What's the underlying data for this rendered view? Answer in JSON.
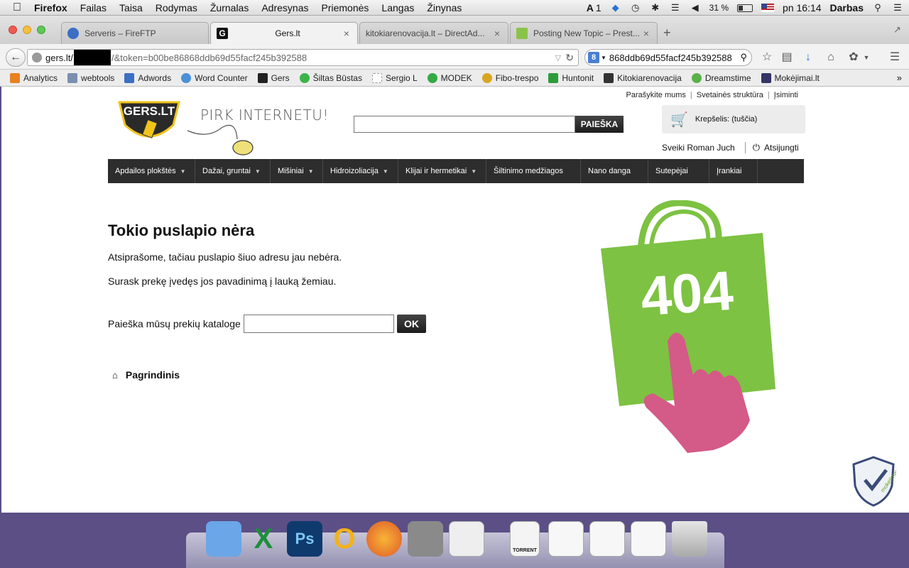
{
  "menubar": {
    "app": "Firefox",
    "items": [
      "Failas",
      "Taisa",
      "Rodymas",
      "Žurnalas",
      "Adresynas",
      "Priemonės",
      "Langas",
      "Žinynas"
    ],
    "status": {
      "adobe_count": "1",
      "battery": "31 %",
      "clock": "pn 16:14",
      "user": "Darbas"
    }
  },
  "tabs": [
    {
      "title": "Serveris – FireFTP"
    },
    {
      "title": "Gers.lt"
    },
    {
      "title": "kitokiarenovacija.lt – DirectAd..."
    },
    {
      "title": "Posting New Topic – Prest..."
    }
  ],
  "navbar": {
    "url_host": "gers.lt/",
    "url_rest": "/&token=b00be86868ddb69d55facf245b392588",
    "search_value": "868ddb69d55facf245b392588"
  },
  "bookmarks": [
    {
      "label": "Analytics",
      "color": "#e8821e"
    },
    {
      "label": "webtools",
      "color": "#7a8fb0"
    },
    {
      "label": "Adwords",
      "color": "#3a6fc4"
    },
    {
      "label": "Word Counter",
      "color": "#4a90d9"
    },
    {
      "label": "Gers",
      "color": "#222222"
    },
    {
      "label": "Šiltas Būstas",
      "color": "#3cb44a"
    },
    {
      "label": "Sergio L",
      "color": "#cccccc"
    },
    {
      "label": "MODEK",
      "color": "#33aa44"
    },
    {
      "label": "Fibo-trespo",
      "color": "#d9a520"
    },
    {
      "label": "Huntonit",
      "color": "#2e9b3a"
    },
    {
      "label": "Kitokiarenovacija",
      "color": "#333333"
    },
    {
      "label": "Dreamstime",
      "color": "#5bb14a"
    },
    {
      "label": "Mokėjimai.lt",
      "color": "#333366"
    }
  ],
  "site": {
    "top_links": [
      "Parašykite mums",
      "Svetainės struktūra",
      "Įsiminti"
    ],
    "logo_text": "GERS.LT",
    "slogan": "PIRK INTERNETU!",
    "search_button": "PAIEŠKA",
    "cart_label": "Krepšelis: (tuščia)",
    "greeting": "Sveiki Roman Juch",
    "logout": "Atsijungti",
    "nav": [
      {
        "label": "Apdailos plokštės",
        "dropdown": true
      },
      {
        "label": "Dažai, gruntai",
        "dropdown": true
      },
      {
        "label": "Mišiniai",
        "dropdown": true
      },
      {
        "label": "Hidroizoliacija",
        "dropdown": true
      },
      {
        "label": "Klijai ir hermetikai",
        "dropdown": true
      },
      {
        "label": "Šiltinimo medžiagos",
        "dropdown": false
      },
      {
        "label": "Nano danga",
        "dropdown": false
      },
      {
        "label": "Sutepėjai",
        "dropdown": false
      },
      {
        "label": "Įrankiai",
        "dropdown": false
      }
    ],
    "error": {
      "title": "Tokio puslapio nėra",
      "p1": "Atsiprašome, tačiau puslapio šiuo adresu jau nebėra.",
      "p2": "Surask prekę įvedęs jos pavadinimą į lauką žemiau.",
      "catalog_label": "Paieška mūsų prekių kataloge",
      "ok_button": "OK",
      "home_link": "Pagrindinis",
      "bag_text": "404"
    },
    "badge_text": "mokejimai.lt"
  },
  "colors": {
    "bag_green": "#7dc242",
    "hand_pink": "#d45a87",
    "nav_dark": "#2d2d2d"
  },
  "dock": [
    {
      "name": "finder-icon",
      "label": "",
      "bg": "#6aa6e8"
    },
    {
      "name": "excel-icon",
      "label": "X",
      "bg": "#1e8f3a"
    },
    {
      "name": "photoshop-icon",
      "label": "Ps",
      "bg": "#0f3a6e"
    },
    {
      "name": "outlook-icon",
      "label": "O",
      "bg": "#f2b21a"
    },
    {
      "name": "firefox-icon",
      "label": "",
      "bg": "#e8702a"
    },
    {
      "name": "script-editor-icon",
      "label": "",
      "bg": "#8a8a8a"
    },
    {
      "name": "textedit-icon",
      "label": "",
      "bg": "#eeeeee"
    },
    {
      "name": "torrent-file-icon",
      "label": "TORRENT",
      "bg": "#f4f4f4"
    },
    {
      "name": "window-thumb-1-icon",
      "label": "",
      "bg": "#f7f7f7"
    },
    {
      "name": "window-thumb-2-icon",
      "label": "",
      "bg": "#f7f7f7"
    },
    {
      "name": "window-thumb-3-icon",
      "label": "",
      "bg": "#f7f7f7"
    },
    {
      "name": "trash-icon",
      "label": "",
      "bg": "#c9c9c9"
    }
  ]
}
